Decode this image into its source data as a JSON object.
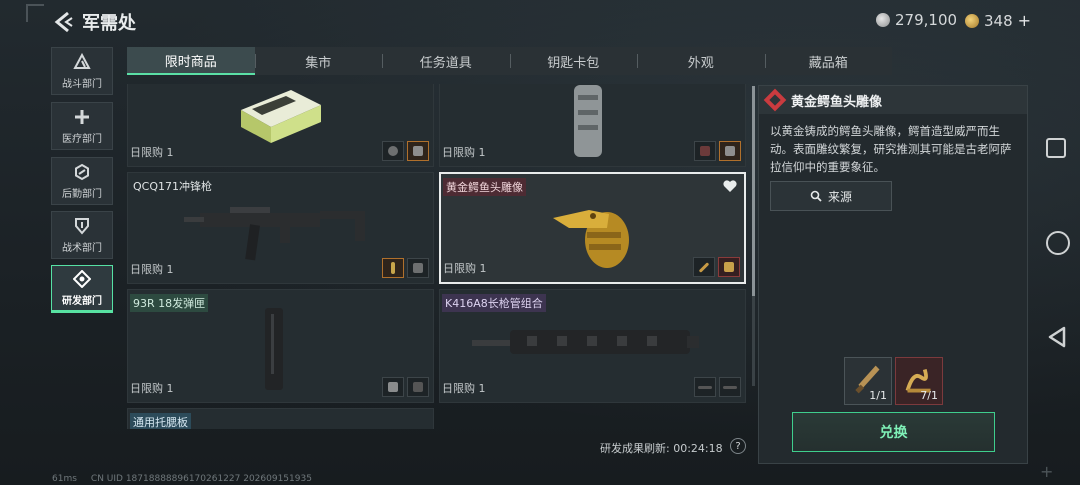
{
  "header": {
    "title": "军需处",
    "currency_silver": "279,100",
    "currency_gold": "348",
    "add_label": "+"
  },
  "departments": [
    {
      "label": "战斗部门",
      "icon": "combat-icon"
    },
    {
      "label": "医疗部门",
      "icon": "medical-cross-icon"
    },
    {
      "label": "后勤部门",
      "icon": "logistics-icon"
    },
    {
      "label": "战术部门",
      "icon": "shield-icon"
    },
    {
      "label": "研发部门",
      "icon": "research-icon",
      "active": true
    }
  ],
  "tabs": [
    {
      "label": "限时商品",
      "active": true
    },
    {
      "label": "集市"
    },
    {
      "label": "任务道具"
    },
    {
      "label": "钥匙卡包"
    },
    {
      "label": "外观"
    },
    {
      "label": "藏品箱"
    }
  ],
  "items": [
    {
      "name": "",
      "limit": "日限购 1"
    },
    {
      "name": "",
      "limit": "日限购 1"
    },
    {
      "name": "QCQ171冲锋枪",
      "limit": "日限购 1"
    },
    {
      "name": "黄金鳄鱼头雕像",
      "limit": "日限购 1",
      "selected": true
    },
    {
      "name": "93R 18发弹匣",
      "limit": "日限购 1"
    },
    {
      "name": "K416A8长枪管组合",
      "limit": "日限购 1"
    },
    {
      "name": "通用托腮板",
      "limit": ""
    }
  ],
  "refresh": {
    "label": "研发成果刷新: 00:24:18",
    "help": "?"
  },
  "detail": {
    "title": "黄金鳄鱼头雕像",
    "description": "以黄金铸成的鳄鱼头雕像，鳄首造型威严而生动。表面雕纹繁复，研究推测其可能是古老阿萨拉信仰中的重要象征。",
    "source_label": "来源",
    "requirements": [
      {
        "count": "1/1"
      },
      {
        "count": "7/1"
      }
    ],
    "redeem_label": "兑换"
  },
  "footer": {
    "ping": "61ms",
    "uid": "CN UID 18718888896170261227 202609151935"
  },
  "colors": {
    "accent": "#58e2a2",
    "rarity_red": "#c93b3f",
    "background": "#1c2226"
  }
}
